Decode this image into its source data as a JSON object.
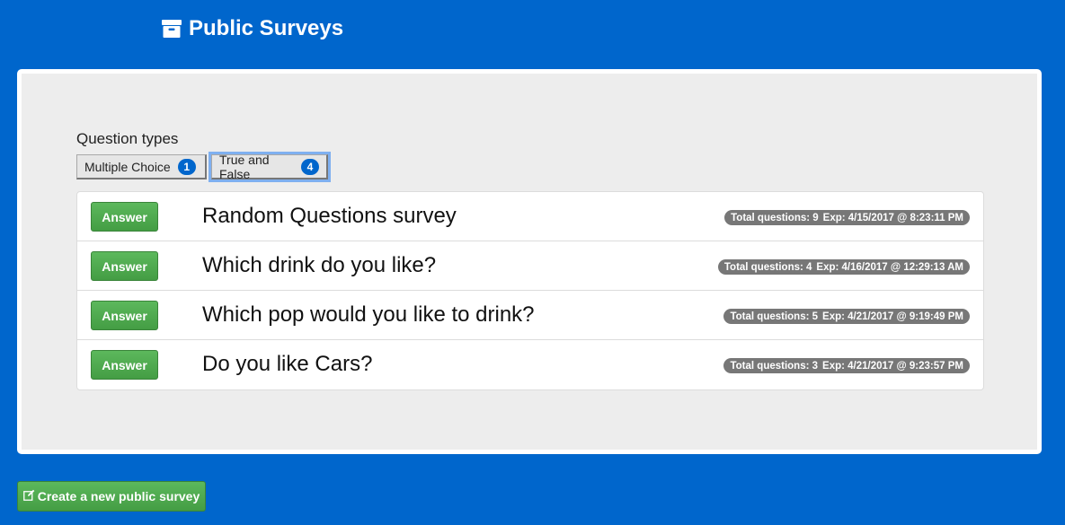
{
  "header": {
    "icon": "archive-box-icon",
    "title": "Public Surveys"
  },
  "filters": {
    "label": "Question types",
    "items": [
      {
        "label": "Multiple Choice",
        "count": "1",
        "active": false
      },
      {
        "label": "True and False",
        "count": "4",
        "active": true
      }
    ]
  },
  "surveys": [
    {
      "button": "Answer",
      "title": "Random Questions survey",
      "total": "Total questions: 9",
      "expires": "Exp: 4/15/2017 @ 8:23:11 PM"
    },
    {
      "button": "Answer",
      "title": "Which drink do you like?",
      "total": "Total questions: 4",
      "expires": "Exp: 4/16/2017 @ 12:29:13 AM"
    },
    {
      "button": "Answer",
      "title": "Which pop would you like to drink?",
      "total": "Total questions: 5",
      "expires": "Exp: 4/21/2017 @ 9:19:49 PM"
    },
    {
      "button": "Answer",
      "title": "Do you like Cars?",
      "total": "Total questions: 3",
      "expires": "Exp: 4/21/2017 @ 9:23:57 PM"
    }
  ],
  "create_button": {
    "icon": "edit-icon",
    "label": "Create a new public survey"
  },
  "colors": {
    "background": "#0066cc",
    "panel": "#ededed",
    "success": "#5cb85c",
    "badge": "#777777",
    "count_badge": "#0066cc"
  }
}
